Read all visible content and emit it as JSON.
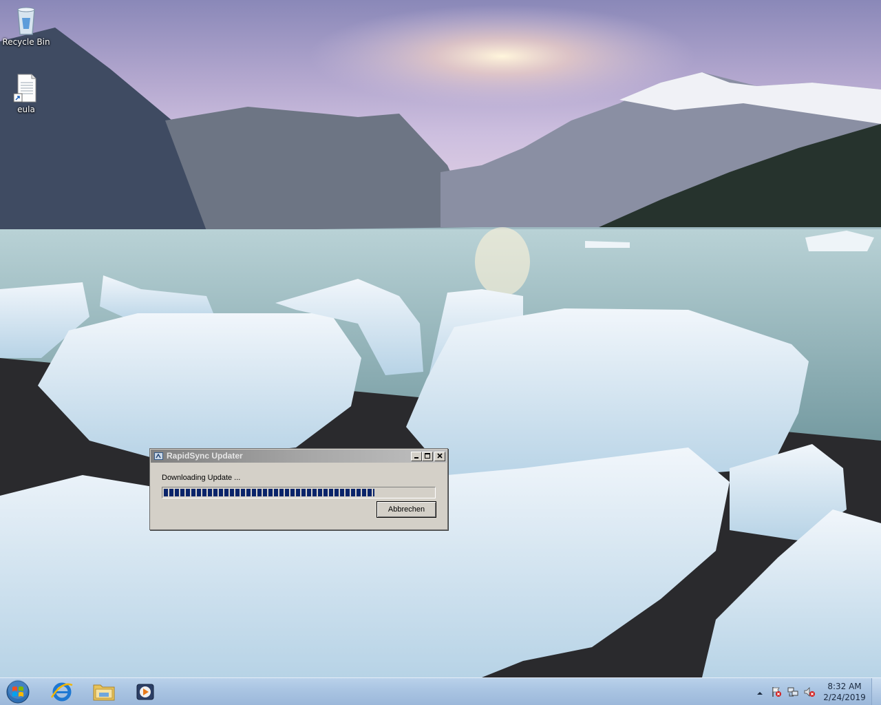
{
  "desktop": {
    "icons": [
      {
        "label": "Recycle Bin",
        "icon": "recycle-bin-icon"
      },
      {
        "label": "eula",
        "icon": "text-file-shortcut-icon"
      }
    ]
  },
  "dialog": {
    "title": "RapidSync Updater",
    "status_text": "Downloading Update ...",
    "progress_fraction": 0.78,
    "cancel_label": "Abbrechen",
    "controls": {
      "minimize": "minimize-icon",
      "maximize": "maximize-icon",
      "close": "close-icon"
    }
  },
  "taskbar": {
    "pinned": [
      {
        "name": "start-orb",
        "icon": "windows-logo-icon"
      },
      {
        "name": "internet-explorer",
        "icon": "internet-explorer-icon"
      },
      {
        "name": "windows-explorer",
        "icon": "folder-icon"
      },
      {
        "name": "media-player",
        "icon": "media-player-icon"
      }
    ],
    "tray": {
      "icons": [
        "show-hidden-icons-icon",
        "action-center-icon",
        "network-icon",
        "volume-muted-icon"
      ],
      "time": "8:32 AM",
      "date": "2/24/2019"
    }
  },
  "colors": {
    "taskbar_top": "#b9d1ea",
    "dialog_face": "#d4d0c8",
    "progress_fill": "#0a246a",
    "titlebar_inactive": "#808080"
  }
}
